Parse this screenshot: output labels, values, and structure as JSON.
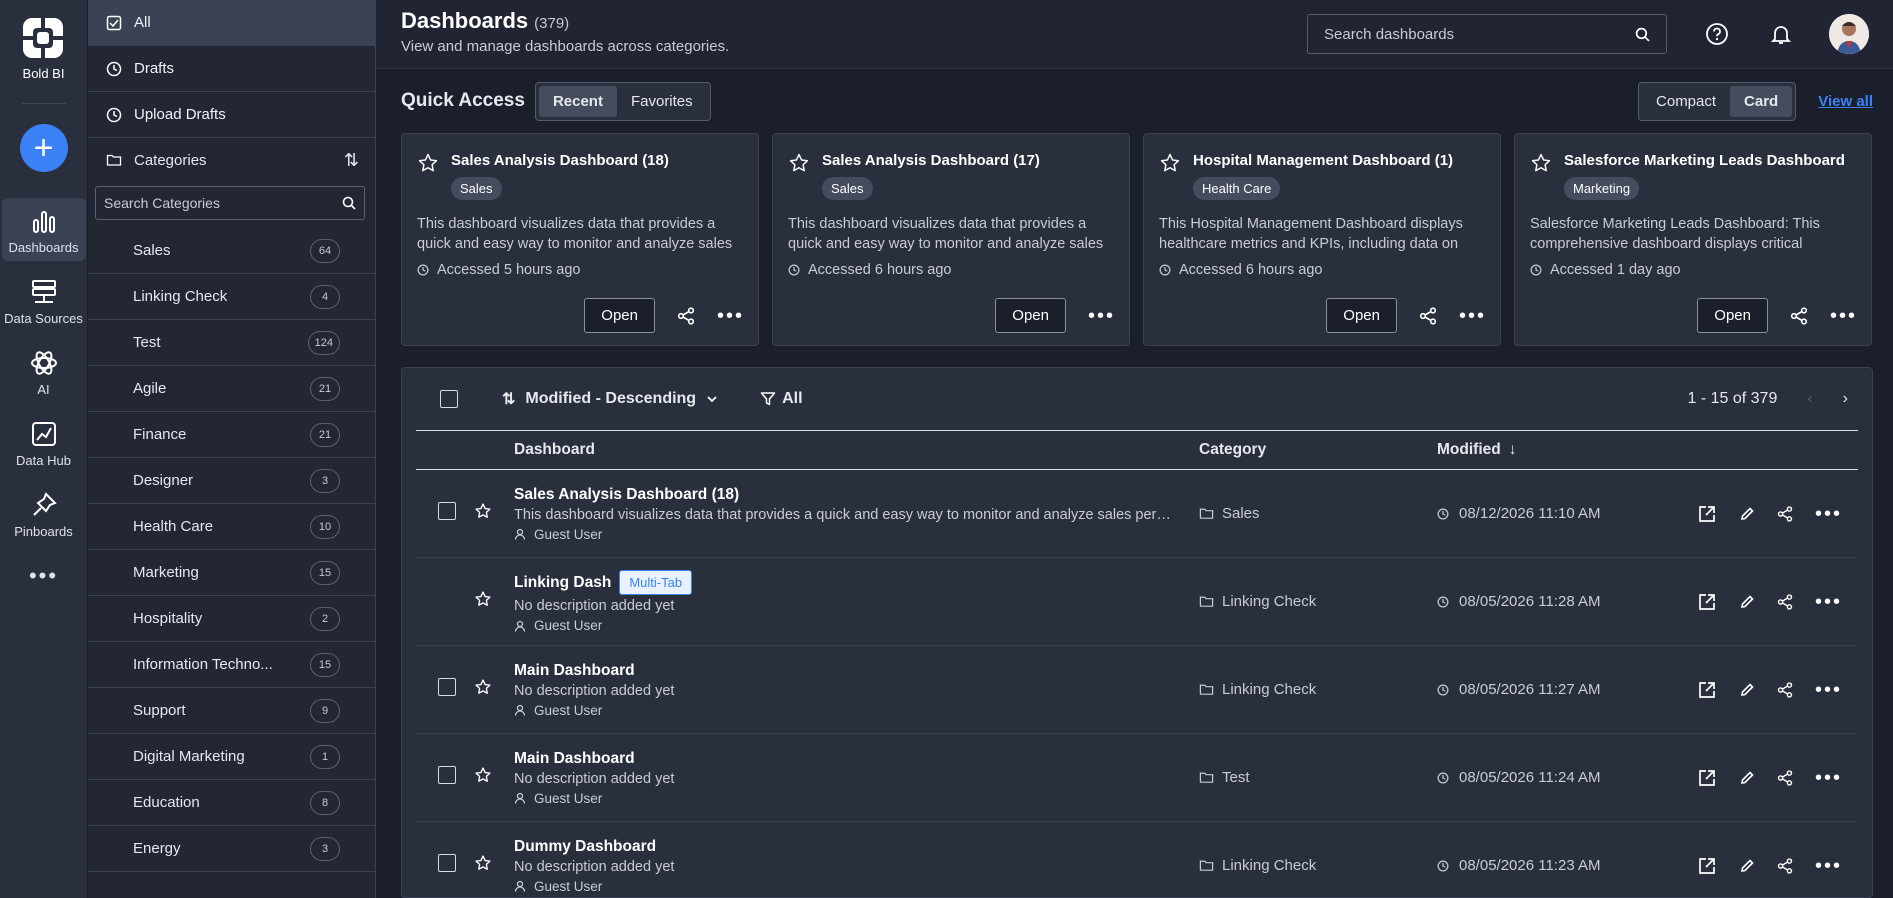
{
  "brand": {
    "name": "Bold BI"
  },
  "rail": {
    "items": [
      {
        "label": "Dashboards",
        "icon": "bar-chart-icon",
        "active": true
      },
      {
        "label": "Data Sources",
        "icon": "server-icon",
        "active": false
      },
      {
        "label": "AI",
        "icon": "atom-icon",
        "active": false
      },
      {
        "label": "Data Hub",
        "icon": "data-hub-icon",
        "active": false
      },
      {
        "label": "Pinboards",
        "icon": "pin-icon",
        "active": false
      }
    ]
  },
  "catpanel": {
    "nav": [
      {
        "label": "All",
        "active": true
      },
      {
        "label": "Drafts"
      },
      {
        "label": "Upload Drafts"
      }
    ],
    "categories_label": "Categories",
    "search_placeholder": "Search Categories",
    "categories": [
      {
        "name": "Sales",
        "count": "64"
      },
      {
        "name": "Linking Check",
        "count": "4"
      },
      {
        "name": "Test",
        "count": "124"
      },
      {
        "name": "Agile",
        "count": "21"
      },
      {
        "name": "Finance",
        "count": "21"
      },
      {
        "name": "Designer",
        "count": "3"
      },
      {
        "name": "Health Care",
        "count": "10"
      },
      {
        "name": "Marketing",
        "count": "15"
      },
      {
        "name": "Hospitality",
        "count": "2"
      },
      {
        "name": "Information Techno...",
        "count": "15"
      },
      {
        "name": "Support",
        "count": "9"
      },
      {
        "name": "Digital Marketing",
        "count": "1"
      },
      {
        "name": "Education",
        "count": "8"
      },
      {
        "name": "Energy",
        "count": "3"
      }
    ]
  },
  "header": {
    "title": "Dashboards",
    "count": "(379)",
    "subtitle": "View and manage dashboards across categories.",
    "search_placeholder": "Search dashboards"
  },
  "quick_access": {
    "title": "Quick Access",
    "tabs": [
      "Recent",
      "Favorites"
    ],
    "views": [
      "Compact",
      "Card"
    ],
    "view_all": "View all",
    "cards": [
      {
        "title": "Sales Analysis Dashboard (18)",
        "tag": "Sales",
        "desc": "This dashboard visualizes data that provides a quick and easy way to monitor and analyze sales performance.",
        "accessed": "Accessed 5 hours ago",
        "open": "Open",
        "share": true
      },
      {
        "title": "Sales Analysis Dashboard (17)",
        "tag": "Sales",
        "desc": "This dashboard visualizes data that provides a quick and easy way to monitor and analyze sales performance.",
        "accessed": "Accessed 6 hours ago",
        "open": "Open",
        "share": false
      },
      {
        "title": "Hospital Management Dashboard (1)",
        "tag": "Health Care",
        "desc": "This Hospital Management Dashboard displays healthcare metrics and KPIs, including data on patients.",
        "accessed": "Accessed 6 hours ago",
        "open": "Open",
        "share": true
      },
      {
        "title": "Salesforce Marketing Leads Dashboard",
        "tag": "Marketing",
        "desc": "Salesforce Marketing Leads Dashboard: This comprehensive dashboard displays critical marketing insights.",
        "accessed": "Accessed 1 day ago",
        "open": "Open",
        "share": true
      }
    ]
  },
  "list": {
    "sort_label": "Modified - Descending",
    "filter_label": "All",
    "pager_text": "1 - 15 of 379",
    "columns": {
      "dashboard": "Dashboard",
      "category": "Category",
      "modified": "Modified"
    },
    "rows": [
      {
        "name": "Sales Analysis Dashboard (18)",
        "badge": "",
        "desc": "This dashboard visualizes data that provides a quick and easy way to monitor and analyze sales performance",
        "owner": "Guest User",
        "category": "Sales",
        "modified": "08/12/2026 11:10 AM",
        "checkbox": true
      },
      {
        "name": "Linking Dash",
        "badge": "Multi-Tab",
        "desc": "No description added yet",
        "owner": "Guest User",
        "category": "Linking Check",
        "modified": "08/05/2026 11:28 AM",
        "checkbox": false
      },
      {
        "name": "Main Dashboard",
        "badge": "",
        "desc": "No description added yet",
        "owner": "Guest User",
        "category": "Linking Check",
        "modified": "08/05/2026 11:27 AM",
        "checkbox": true
      },
      {
        "name": "Main Dashboard",
        "badge": "",
        "desc": "No description added yet",
        "owner": "Guest User",
        "category": "Test",
        "modified": "08/05/2026 11:24 AM",
        "checkbox": true
      },
      {
        "name": "Dummy Dashboard",
        "badge": "",
        "desc": "No description added yet",
        "owner": "Guest User",
        "category": "Linking Check",
        "modified": "08/05/2026 11:23 AM",
        "checkbox": true
      }
    ]
  },
  "colors": {
    "accent": "#3b82f6",
    "bg": "#1b1f2b",
    "panel": "#2a2f3d"
  }
}
